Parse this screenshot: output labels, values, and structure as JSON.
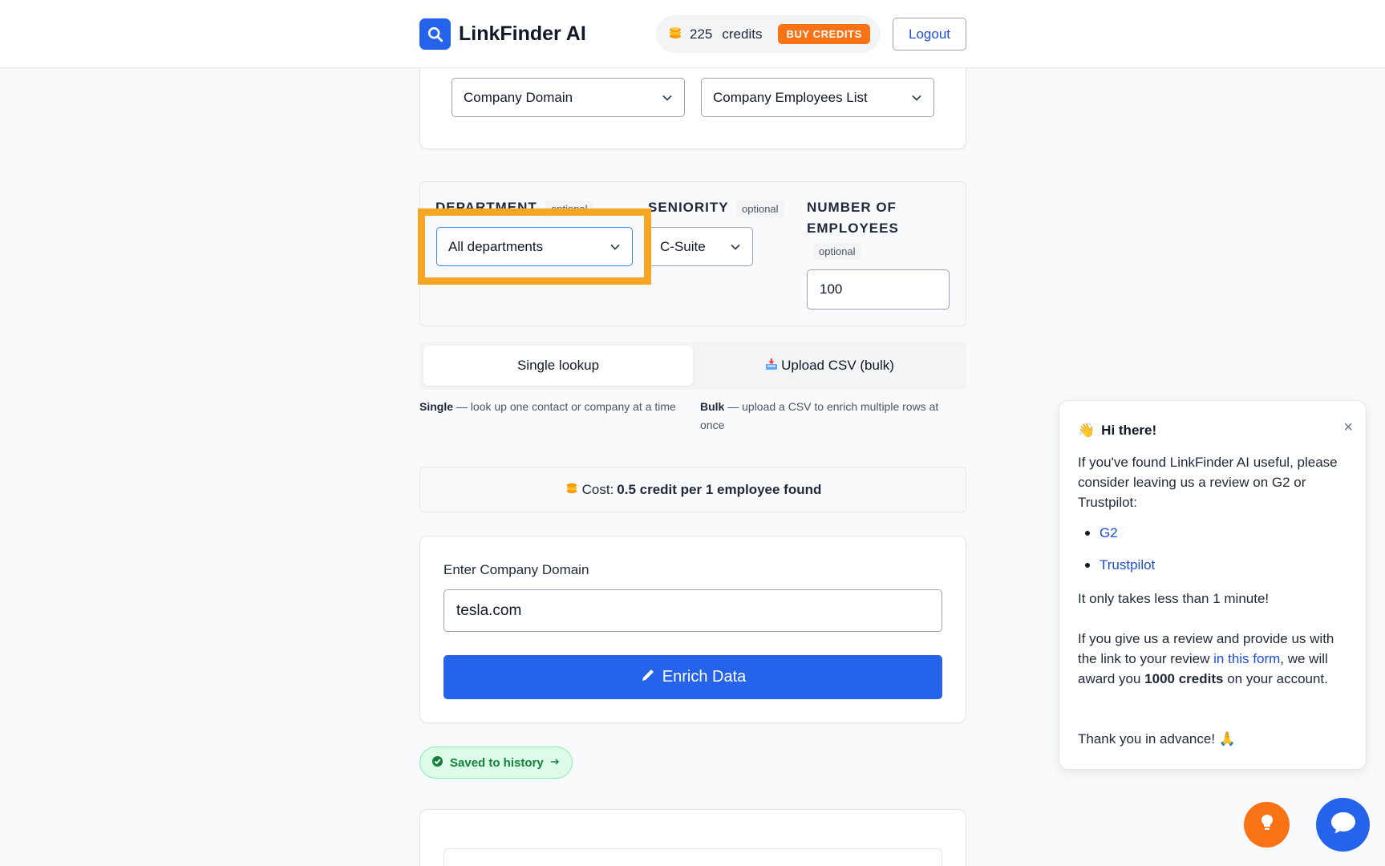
{
  "header": {
    "brand_name": "LinkFinder AI",
    "credits_count": "225",
    "credits_word": "credits",
    "buy_label": "BUY CREDITS",
    "logout_label": "Logout"
  },
  "selectors": {
    "source": "Company Domain",
    "mode": "Company Employees List"
  },
  "filters": {
    "department_label": "DEPARTMENT",
    "department_optional": "optional",
    "department_value": "All departments",
    "seniority_label": "SENIORITY",
    "seniority_optional": "optional",
    "seniority_value": "C-Suite",
    "employees_label_line1": "NUMBER OF",
    "employees_label_line2": "EMPLOYEES",
    "employees_optional": "optional",
    "employees_value": "100"
  },
  "tabs": {
    "single_label": "Single lookup",
    "bulk_label": "Upload CSV (bulk)",
    "single_desc_bold": "Single",
    "single_desc": " — look up one contact or company at a time",
    "bulk_desc_bold": "Bulk",
    "bulk_desc": " — upload a CSV to enrich multiple rows at once"
  },
  "cost": {
    "prefix": "Cost:",
    "value": "0.5 credit per 1 employee found"
  },
  "form": {
    "label": "Enter Company Domain",
    "value": "tesla.com",
    "button_label": "Enrich Data"
  },
  "saved": {
    "label": "Saved to history"
  },
  "popup": {
    "title": "Hi there!",
    "intro": "If you've found LinkFinder AI useful, please consider leaving us a review on G2 or Trustpilot:",
    "link_g2": "G2",
    "link_trustpilot": "Trustpilot",
    "takes": "It only takes less than 1 minute!",
    "reward_part1": "If you give us a review and provide us with the link to your review ",
    "reward_link": "in this form",
    "reward_part2": ", we will award you ",
    "reward_bold": "1000 credits",
    "reward_part3": " on your account.",
    "thanks": "Thank you in advance! 🙏"
  },
  "colors": {
    "primary": "#2563eb",
    "orange": "#f97316",
    "highlight": "#f6a623",
    "success": "#15803d"
  }
}
